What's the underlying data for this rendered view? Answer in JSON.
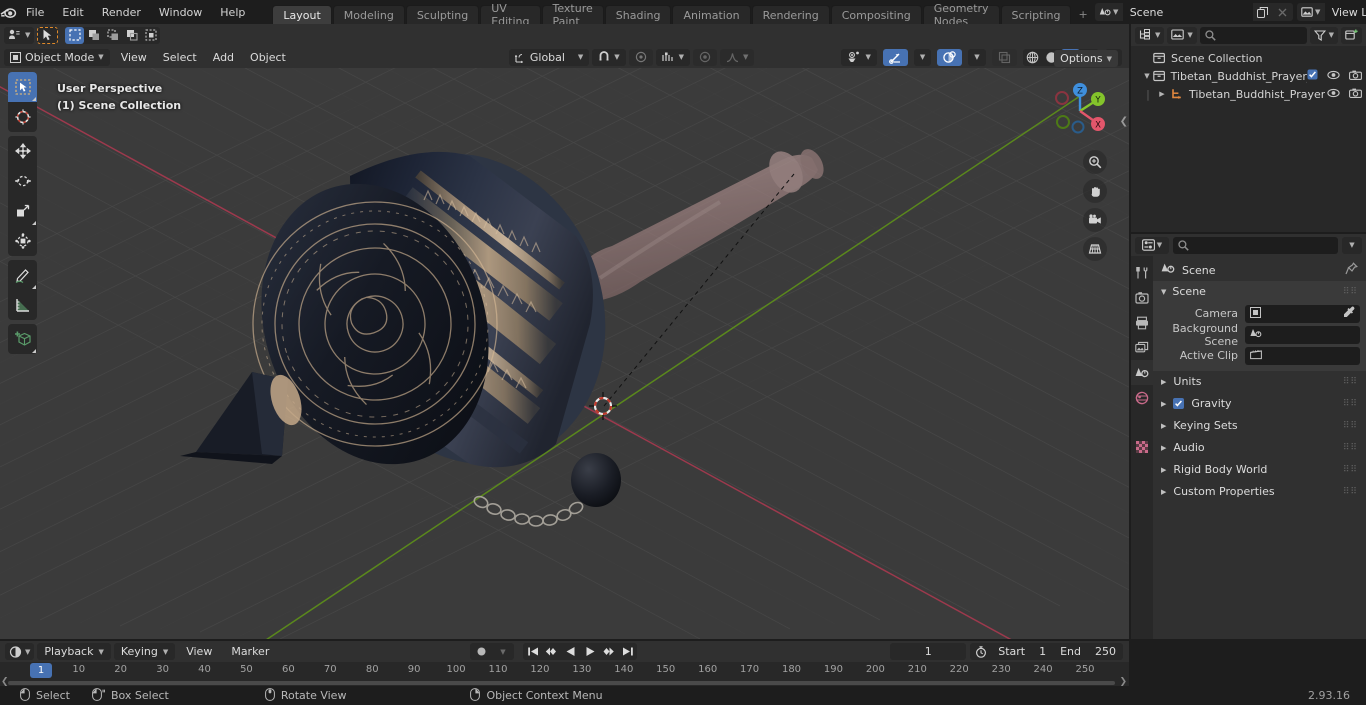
{
  "app": {
    "version": "2.93.16",
    "logo_icon": "blender-logo"
  },
  "topbar": {
    "menus": [
      "File",
      "Edit",
      "Render",
      "Window",
      "Help"
    ],
    "workspace_tabs": [
      {
        "label": "Layout",
        "active": true
      },
      {
        "label": "Modeling",
        "active": false
      },
      {
        "label": "Sculpting",
        "active": false
      },
      {
        "label": "UV Editing",
        "active": false
      },
      {
        "label": "Texture Paint",
        "active": false
      },
      {
        "label": "Shading",
        "active": false
      },
      {
        "label": "Animation",
        "active": false
      },
      {
        "label": "Rendering",
        "active": false
      },
      {
        "label": "Compositing",
        "active": false
      },
      {
        "label": "Geometry Nodes",
        "active": false
      },
      {
        "label": "Scripting",
        "active": false
      }
    ],
    "add_workspace_label": "+",
    "scene": {
      "icon": "scene-icon",
      "name": "Scene",
      "new_icon": "duplicate-icon",
      "unlink_icon": "x-icon"
    },
    "view_layer": {
      "icon": "view-layer-icon",
      "name": "View Layer",
      "new_icon": "duplicate-icon",
      "unlink_icon": "x-icon"
    }
  },
  "viewport": {
    "header": {
      "editor_type_icon": "editor-type-3dview-icon",
      "cursor_tool_icon": "cursor-select-icon",
      "select_modes": [
        "select-box-icon",
        "select-box-extend-icon",
        "select-box-subtract-icon",
        "select-box-invert-icon",
        "select-box-intersect-icon"
      ],
      "mode": "Object Mode",
      "mode_icon": "object-mode-icon",
      "menus": [
        "View",
        "Select",
        "Add",
        "Object"
      ],
      "transform_orientation": "Global",
      "transform_orientation_icon": "orientation-global-icon",
      "snap_icon": "magnet-icon",
      "proportional_icon": "proportional-edit-icon",
      "proportional_falloff_icon": "falloff-smooth-icon",
      "options_label": "Options",
      "visibility_icon": "visibility-icon",
      "gizmo_icon": "gizmo-icon",
      "overlays_icon": "overlays-icon",
      "xray_icon": "xray-icon",
      "shading_modes": [
        "wireframe-icon",
        "solid-icon",
        "material-preview-icon",
        "rendered-icon"
      ],
      "shading_active_index": 2
    },
    "overlay_text": {
      "perspective": "User Perspective",
      "collection": "(1) Scene Collection"
    },
    "toolbar": [
      {
        "name": "tweak-tool",
        "icon": "cursor-arrow-icon",
        "active": true,
        "has_submenu": true
      },
      {
        "name": "cursor-tool",
        "icon": "3d-cursor-icon",
        "active": false,
        "has_submenu": false
      },
      {
        "name": "move-tool",
        "icon": "move-arrows-icon",
        "active": false,
        "has_submenu": false
      },
      {
        "name": "rotate-tool",
        "icon": "rotate-icon",
        "active": false,
        "has_submenu": false
      },
      {
        "name": "scale-tool",
        "icon": "scale-icon",
        "active": false,
        "has_submenu": true
      },
      {
        "name": "transform-tool",
        "icon": "transform-icon",
        "active": false,
        "has_submenu": false
      },
      {
        "name": "annotate-tool",
        "icon": "pencil-icon",
        "active": false,
        "has_submenu": true
      },
      {
        "name": "measure-tool",
        "icon": "ruler-icon",
        "active": false,
        "has_submenu": false
      },
      {
        "name": "add-cube-tool",
        "icon": "add-cube-icon",
        "active": false,
        "has_submenu": true
      }
    ],
    "nav_gizmo": {
      "axes": [
        {
          "label": "Z",
          "color": "#3f8fdd",
          "filled": true
        },
        {
          "label": "Y",
          "color": "#84c42b",
          "filled": true
        },
        {
          "label": "X",
          "color": "#e3566b",
          "filled": true
        },
        {
          "label": "",
          "color": "#8a3440",
          "filled": false
        },
        {
          "label": "",
          "color": "#4d7a16",
          "filled": false
        },
        {
          "label": "",
          "color": "#2a5c8a",
          "filled": false
        }
      ]
    },
    "nav_buttons": [
      "zoom-icon",
      "hand-pan-icon",
      "camera-icon",
      "perspective-ortho-icon"
    ],
    "scene_object": "Tibetan Buddhist prayer wheel 3D model"
  },
  "outliner": {
    "display_mode_icon": "outliner-display-mode-icon",
    "filter_id_icon": "outliner-id-icon",
    "search_placeholder": "",
    "search_icon": "search-icon",
    "filter_icon": "filter-funnel-icon",
    "new_collection_icon": "new-collection-icon",
    "rows": [
      {
        "label": "Scene Collection",
        "icon": "collection-icon",
        "depth": 0,
        "expand": "none",
        "checkbox": false,
        "eye": false,
        "camera": false
      },
      {
        "label": "Tibetan_Buddhist_Prayer_Wh",
        "icon": "collection-icon",
        "depth": 1,
        "expand": "open",
        "checkbox": true,
        "eye": true,
        "camera": true
      },
      {
        "label": "Tibetan_Buddhist_Prayer",
        "icon": "mesh-object-icon",
        "depth": 2,
        "expand": "closed",
        "checkbox": false,
        "eye": true,
        "camera": true
      }
    ]
  },
  "properties": {
    "editor_icon": "properties-editor-icon",
    "search_icon": "search-icon",
    "search_placeholder": "",
    "dropdown_icon": "chevron-down-icon",
    "tabs": [
      {
        "name": "tool-tab",
        "icon": "tool-wrench-icon",
        "active": false
      },
      {
        "name": "render-tab",
        "icon": "render-camera-icon",
        "active": false
      },
      {
        "name": "output-tab",
        "icon": "output-printer-icon",
        "active": false
      },
      {
        "name": "view-layer-tab",
        "icon": "view-layer-images-icon",
        "active": false
      },
      {
        "name": "scene-tab",
        "icon": "scene-cone-icon",
        "active": true
      },
      {
        "name": "world-tab",
        "icon": "world-globe-icon",
        "active": false
      },
      {
        "name": "texture-tab",
        "icon": "texture-checker-icon",
        "active": false
      }
    ],
    "breadcrumb": {
      "icon": "scene-cone-icon",
      "label": "Scene",
      "pin_icon": "pin-icon"
    },
    "panels": [
      {
        "label": "Scene",
        "open": true,
        "fields": [
          {
            "label": "Camera",
            "value": "",
            "icon": "camera-data-icon",
            "tail_icon": "eyedropper-icon"
          },
          {
            "label": "Background Scene",
            "value": "",
            "icon": "scene-cone-icon",
            "tail_icon": ""
          },
          {
            "label": "Active Clip",
            "value": "",
            "icon": "movie-clip-icon",
            "tail_icon": ""
          }
        ]
      },
      {
        "label": "Units",
        "open": false,
        "checkbox": null
      },
      {
        "label": "Gravity",
        "open": false,
        "checkbox": true
      },
      {
        "label": "Keying Sets",
        "open": false,
        "checkbox": null
      },
      {
        "label": "Audio",
        "open": false,
        "checkbox": null
      },
      {
        "label": "Rigid Body World",
        "open": false,
        "checkbox": null
      },
      {
        "label": "Custom Properties",
        "open": false,
        "checkbox": null
      }
    ]
  },
  "timeline": {
    "editor_icon": "timeline-editor-icon",
    "playback_label": "Playback",
    "keying_label": "Keying",
    "menus": [
      "View",
      "Marker"
    ],
    "record_icon": "record-dot-icon",
    "record_dropdown_icon": "chevron-down-icon",
    "transport": [
      "jump-to-start-icon",
      "jump-to-prev-keyframe-icon",
      "play-reverse-icon",
      "play-icon",
      "jump-to-next-keyframe-icon",
      "jump-to-end-icon"
    ],
    "current_frame": "1",
    "frame_icon": "stopwatch-icon",
    "start_label": "Start",
    "start_value": "1",
    "end_label": "End",
    "end_value": "250",
    "playhead_frame": "1",
    "ruler_ticks": [
      "10",
      "20",
      "30",
      "40",
      "50",
      "60",
      "70",
      "80",
      "90",
      "100",
      "110",
      "120",
      "130",
      "140",
      "150",
      "160",
      "170",
      "180",
      "190",
      "200",
      "210",
      "220",
      "230",
      "240",
      "250"
    ]
  },
  "statusbar": {
    "items": [
      {
        "icon": "mouse-left-icon",
        "label": "Select"
      },
      {
        "icon": "mouse-left-drag-icon",
        "label": "Box Select"
      },
      {
        "icon": "mouse-middle-icon",
        "label": "Rotate View"
      },
      {
        "icon": "mouse-right-icon",
        "label": "Object Context Menu"
      }
    ],
    "version": "2.93.16"
  },
  "colors": {
    "accent_blue": "#4772b3",
    "panel_bg": "#303030",
    "editor_bg": "#282828",
    "viewport_bg": "#3b3b3b",
    "axis_x_red": "#c1435a",
    "axis_y_green": "#6fa81e",
    "text": "#dcdcdc"
  }
}
